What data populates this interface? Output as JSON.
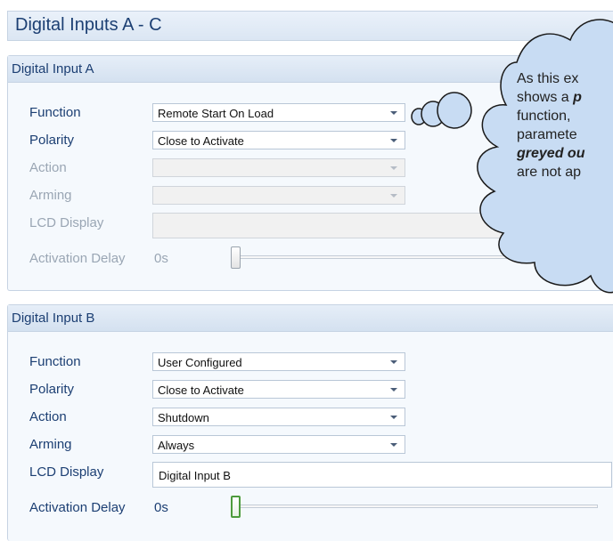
{
  "header": {
    "title": "Digital Inputs A - C"
  },
  "input_a": {
    "title": "Digital Input A",
    "function": {
      "label": "Function",
      "value": "Remote Start On Load"
    },
    "polarity": {
      "label": "Polarity",
      "value": "Close to Activate"
    },
    "action": {
      "label": "Action",
      "value": ""
    },
    "arming": {
      "label": "Arming",
      "value": ""
    },
    "lcd_display": {
      "label": "LCD Display",
      "value": ""
    },
    "activation_delay": {
      "label": "Activation Delay",
      "value": "0s",
      "slider_fraction": 0
    }
  },
  "input_b": {
    "title": "Digital Input B",
    "function": {
      "label": "Function",
      "value": "User Configured"
    },
    "polarity": {
      "label": "Polarity",
      "value": "Close to Activate"
    },
    "action": {
      "label": "Action",
      "value": "Shutdown"
    },
    "arming": {
      "label": "Arming",
      "value": "Always"
    },
    "lcd_display": {
      "label": "LCD Display",
      "value": "Digital Input B"
    },
    "activation_delay": {
      "label": "Activation Delay",
      "value": "0s",
      "slider_fraction": 0
    }
  },
  "callout": {
    "line1": "As this ex",
    "line2_a": "shows a ",
    "line2_b": "p",
    "line3": "function,",
    "line4": "paramete",
    "line5": "greyed ou",
    "line6": "are not ap"
  },
  "colors": {
    "accent_text": "#1c3f73",
    "disabled_text": "#9aa6b4",
    "cloud_fill": "#c8dcf3",
    "slider_active": "#4d9b3d"
  },
  "icons": {
    "dropdown": "chevron-down-icon"
  }
}
